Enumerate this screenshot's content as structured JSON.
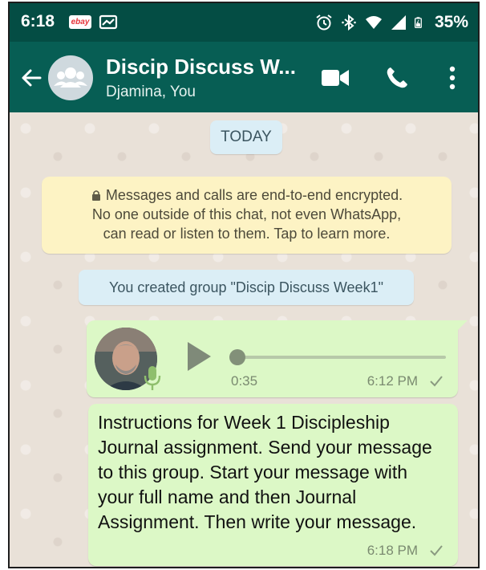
{
  "status_bar": {
    "time": "6:18",
    "ebay_badge": "ebay",
    "icons": [
      "ebay-icon",
      "cast-notification-icon",
      "alarm-icon",
      "bluetooth-icon",
      "wifi-icon",
      "signal-icon",
      "battery-icon"
    ],
    "battery_percent": "35%"
  },
  "header": {
    "title": "Discip Discuss W...",
    "subtitle": "Djamina, You",
    "icons": [
      "back-arrow-icon",
      "group-avatar-icon",
      "video-call-icon",
      "phone-call-icon",
      "more-menu-icon"
    ]
  },
  "chat": {
    "date_chip": "TODAY",
    "encryption_notice": {
      "line1": "Messages and calls are end-to-end encrypted.",
      "line2": "No one outside of this chat, not even WhatsApp,",
      "line3": "can read or listen to them. Tap to learn more."
    },
    "system_message": "You created group \"Discip Discuss Week1\"",
    "messages": [
      {
        "type": "voice",
        "duration": "0:35",
        "time": "6:12 PM",
        "progress": 0.0
      },
      {
        "type": "text",
        "text": "Instructions for Week 1 Discipleship Journal assignment. Send your message to this group. Start your message with your full name and then Journal Assignment. Then write your message.",
        "time": "6:18 PM"
      }
    ]
  },
  "colors": {
    "status_bar": "#044d44",
    "app_bar": "#075e54",
    "chat_background": "#e9e1d8",
    "outgoing_bubble": "#dcf8c6",
    "notice_yellow": "#fdf3c4",
    "chip_blue": "#dbeef6"
  }
}
